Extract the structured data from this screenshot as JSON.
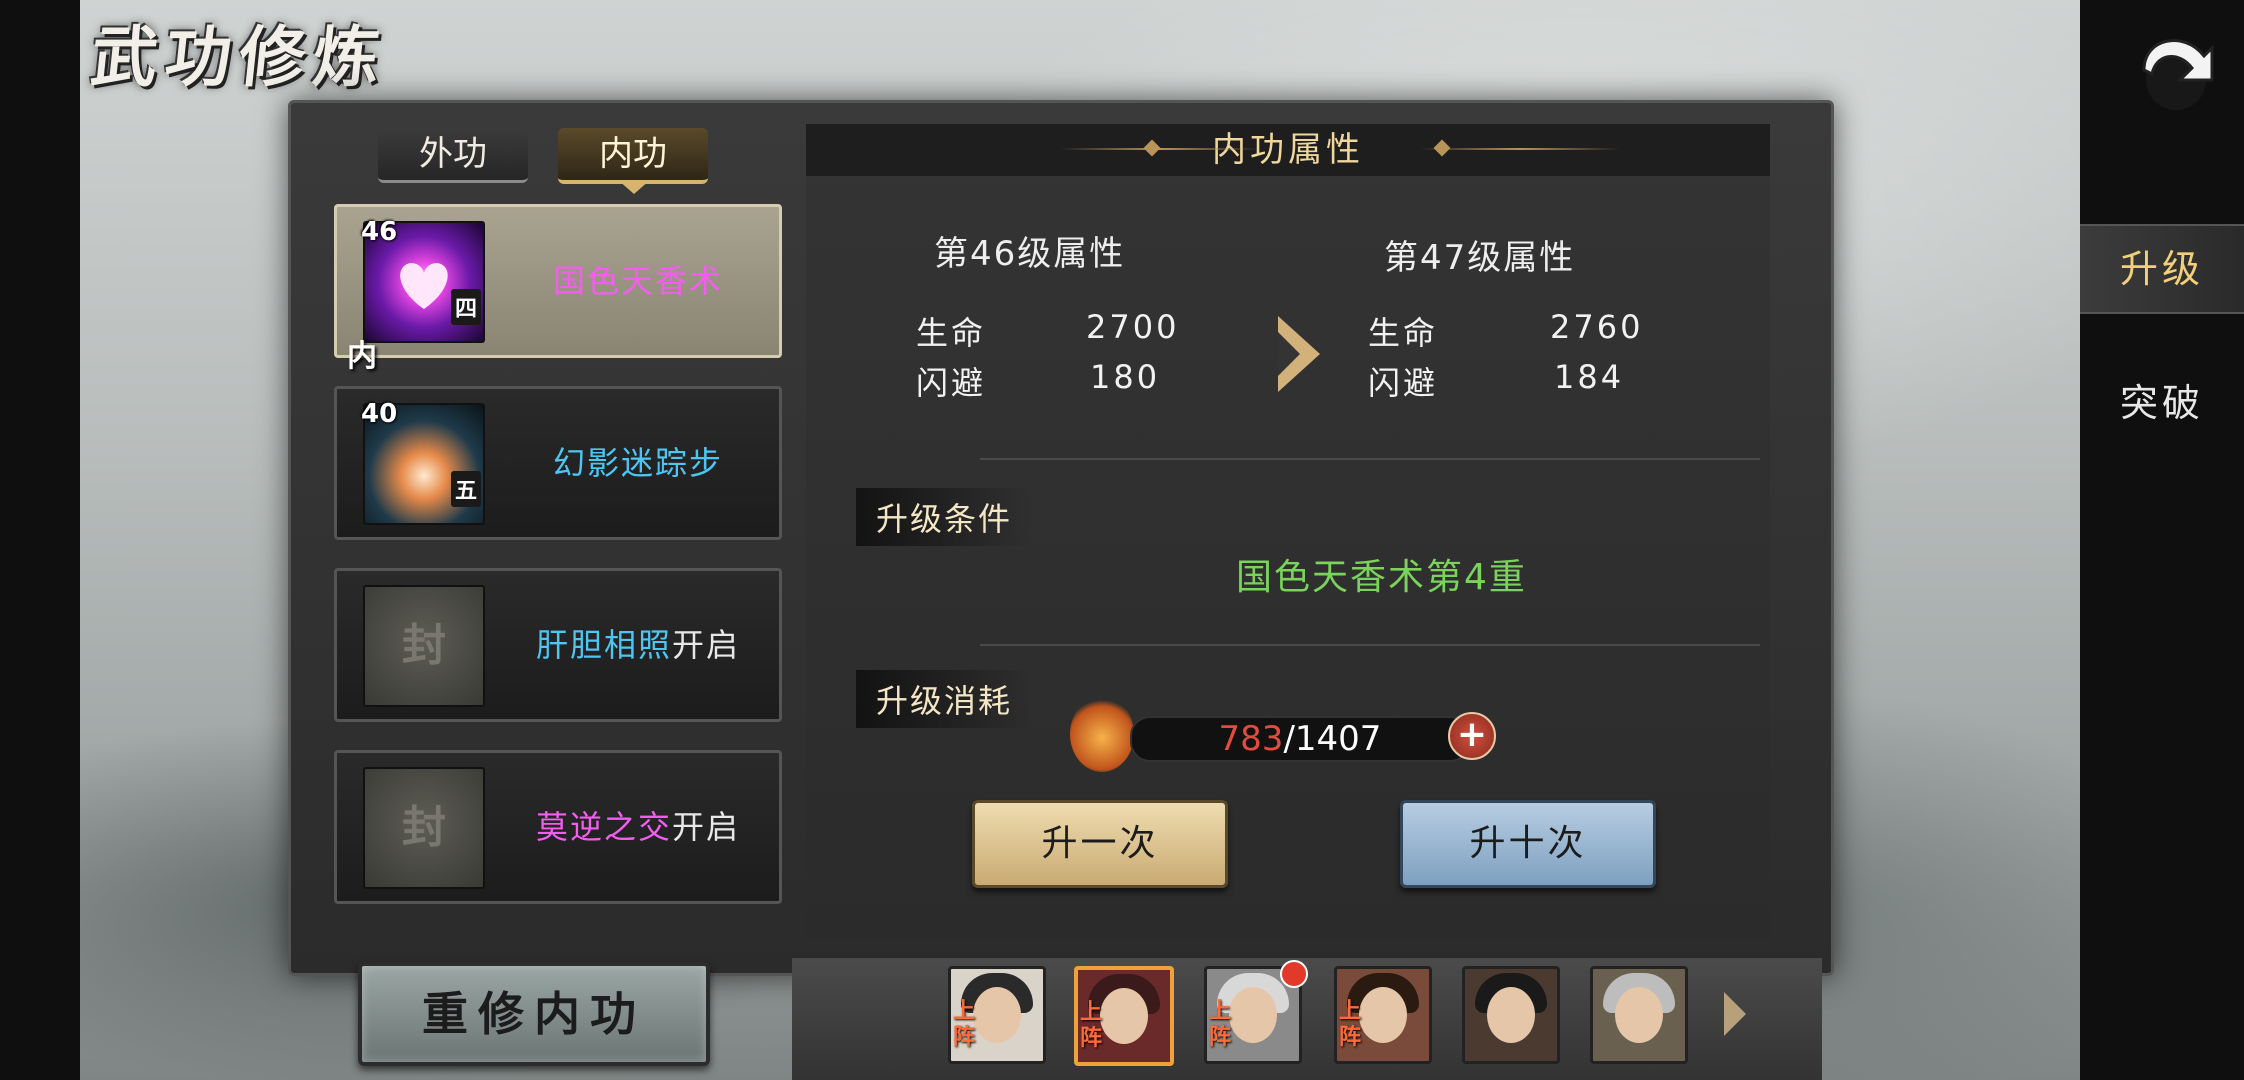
{
  "title": "武功修炼",
  "tabs": {
    "outer": "外功",
    "inner": "内功"
  },
  "skills": [
    {
      "level": "46",
      "name": "国色天香术",
      "name_color": "#f55df0",
      "tier": "四",
      "type": "内",
      "open_suffix": ""
    },
    {
      "level": "40",
      "name": "幻影迷踪步",
      "name_color": "#4cc6f5",
      "tier": "五",
      "type": "",
      "open_suffix": ""
    },
    {
      "level": "",
      "name": "肝胆相照",
      "name_color": "#4cc6f5",
      "tier": "",
      "type": "",
      "open_suffix": "开启",
      "lock_glyph": "封"
    },
    {
      "level": "",
      "name": "莫逆之交",
      "name_color": "#f55df0",
      "tier": "",
      "type": "",
      "open_suffix": "开启",
      "lock_glyph": "封"
    }
  ],
  "rebuild_label": "重修内功",
  "panel": {
    "header": "内功属性",
    "current_level_title": "第46级属性",
    "next_level_title": "第47级属性",
    "current_stats": [
      {
        "label": "生命",
        "value": "2700"
      },
      {
        "label": "闪避",
        "value": "180"
      }
    ],
    "next_stats": [
      {
        "label": "生命",
        "value": "2760"
      },
      {
        "label": "闪避",
        "value": "184"
      }
    ],
    "condition_label": "升级条件",
    "condition_text": "国色天香术第4重",
    "cost_label": "升级消耗",
    "cost_current": "783",
    "cost_total": "/1407",
    "plus": "+",
    "upgrade_once": "升一次",
    "upgrade_ten": "升十次"
  },
  "side_tabs": {
    "upgrade": "升级",
    "breakthrough": "突破"
  },
  "characters": [
    {
      "tag": "上阵",
      "hair": "#2a2a2a"
    },
    {
      "tag": "上阵",
      "hair": "#3a1a1a"
    },
    {
      "tag": "上阵",
      "hair": "#d8d8d8"
    },
    {
      "tag": "上阵",
      "hair": "#2a1a10"
    },
    {
      "tag": "",
      "hair": "#1a1a1a"
    },
    {
      "tag": "",
      "hair": "#bdbdbd"
    }
  ],
  "colors": {
    "accent_gold": "#f2cf7a",
    "condition_green": "#7ad35a",
    "cost_red": "#e24c3c"
  }
}
